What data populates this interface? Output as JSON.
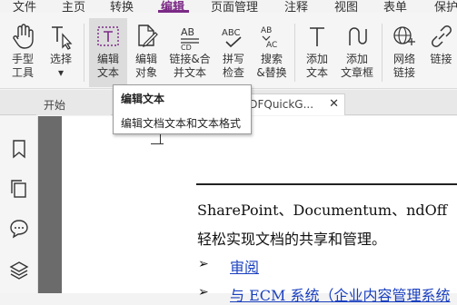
{
  "menu": {
    "items": [
      "文件",
      "主页",
      "转换",
      "编辑",
      "页面管理",
      "注释",
      "视图",
      "表单",
      "保护"
    ],
    "active": "编辑"
  },
  "ribbon": {
    "tools": [
      {
        "line1": "手型",
        "line2": "工具",
        "icon": "hand-icon"
      },
      {
        "line1": "选择",
        "line2": "▾",
        "icon": "select-cursor-icon"
      },
      {
        "line1": "编辑",
        "line2": "文本",
        "icon": "edit-text-icon"
      },
      {
        "line1": "编辑",
        "line2": "对象",
        "icon": "edit-object-icon"
      },
      {
        "line1": "链接&合",
        "line2": "并文本",
        "icon": "link-merge-text-icon"
      },
      {
        "line1": "拼写",
        "line2": "检查",
        "icon": "spell-check-icon"
      },
      {
        "line1": "搜索",
        "line2": "&替换",
        "icon": "search-replace-icon"
      },
      {
        "line1": "添加",
        "line2": "文本",
        "icon": "add-text-icon"
      },
      {
        "line1": "添加",
        "line2": "文章框",
        "icon": "add-article-box-icon"
      },
      {
        "line1": "网络",
        "line2": "链接",
        "icon": "web-link-icon"
      },
      {
        "line1": "链接",
        "line2": "",
        "icon": "link-icon"
      }
    ]
  },
  "tabs": {
    "start_label": "开始",
    "doc_label": "PDFQuickG..."
  },
  "tooltip": {
    "title": "编辑文本",
    "description": "编辑文档文本和文本格式"
  },
  "document": {
    "line1": "SharePoint、Documentum、ndOff",
    "line2": "轻松实现文档的共享和管理。",
    "link1": "审阅",
    "link2": "与 ECM 系统（企业内容管理系统"
  },
  "colors": {
    "accent": "#7b2a86",
    "link": "#1a3fbf",
    "doc_background": "#6b6b6b"
  }
}
